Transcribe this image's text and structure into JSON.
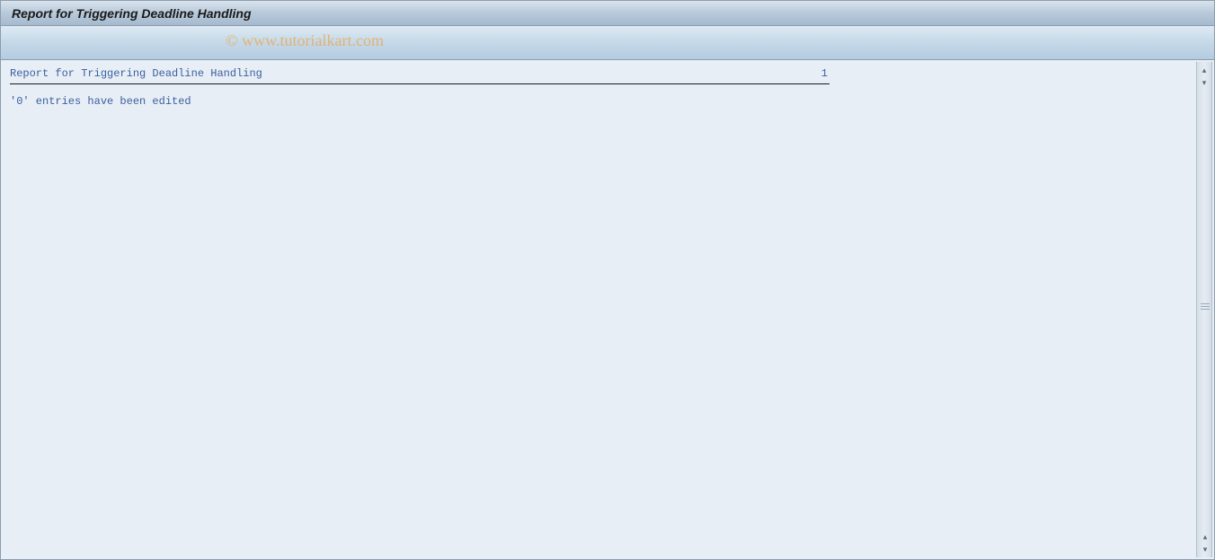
{
  "window": {
    "title": "Report for Triggering Deadline Handling"
  },
  "watermark": "© www.tutorialkart.com",
  "report": {
    "header_title": "Report for Triggering Deadline Handling",
    "page_number": "1",
    "body_message": "'0' entries have been edited"
  }
}
